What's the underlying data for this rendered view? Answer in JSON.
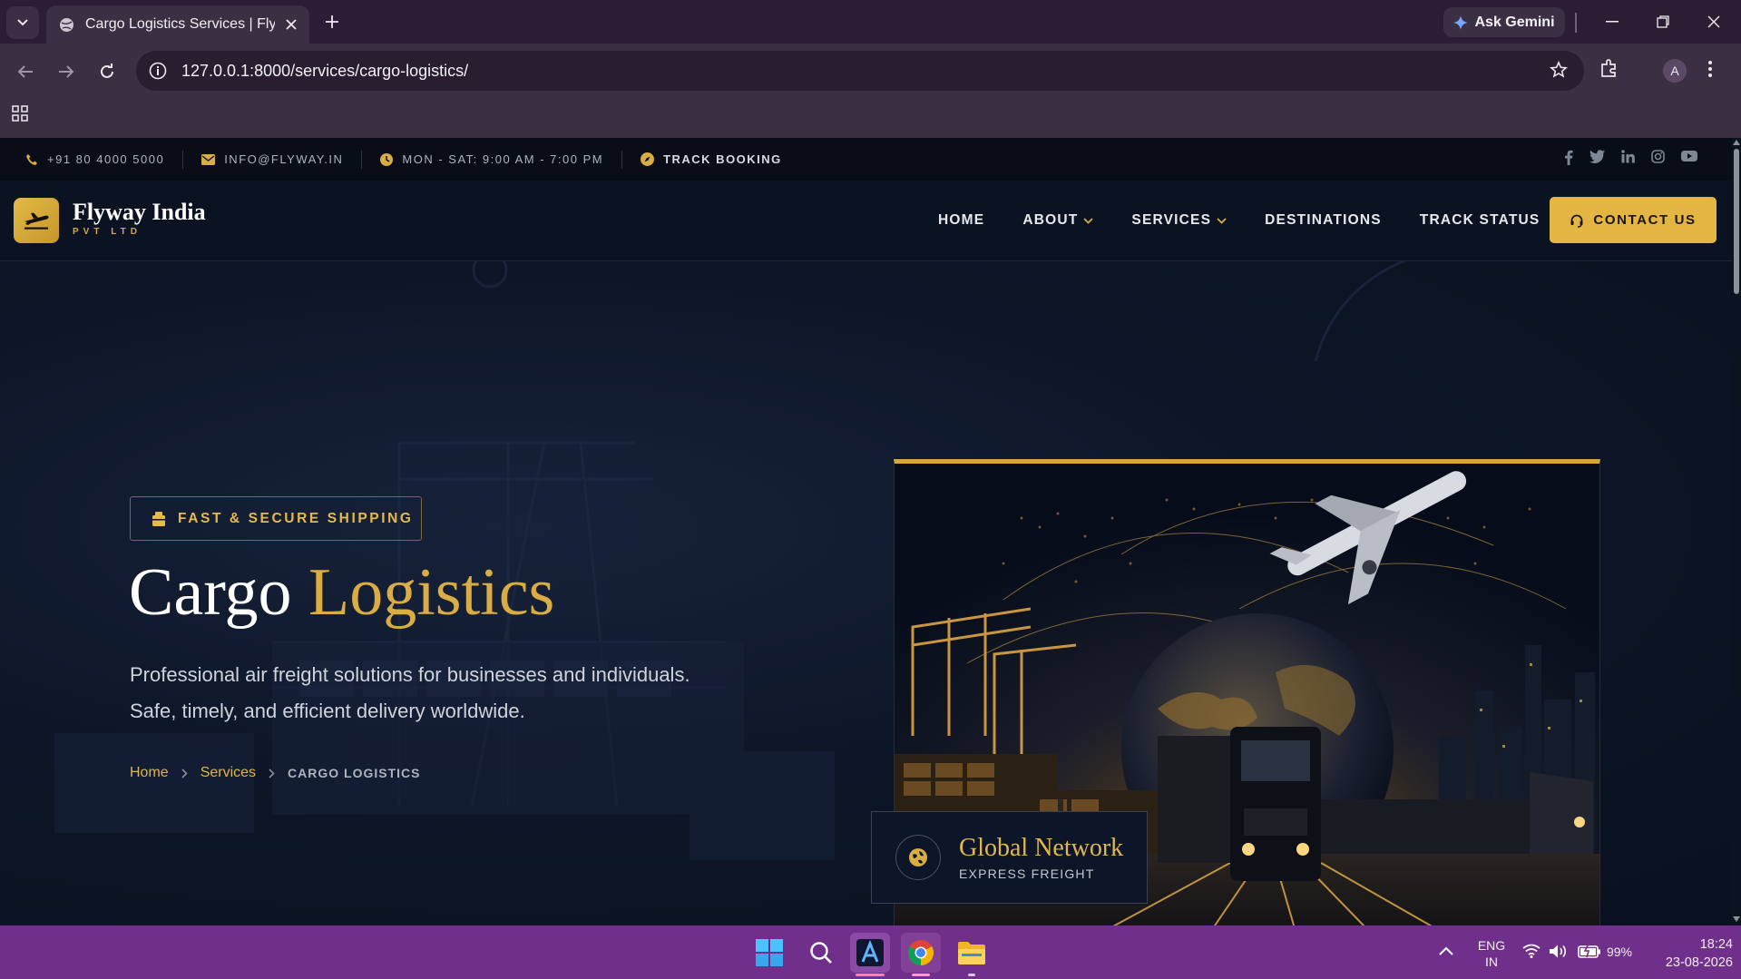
{
  "browser": {
    "tab_title": "Cargo Logistics Services | Flyway",
    "url": "127.0.0.1:8000/services/cargo-logistics/",
    "gemini_label": "Ask Gemini",
    "profile_initial": "A"
  },
  "topbar": {
    "phone": "+91 80 4000 5000",
    "email": "INFO@FLYWAY.IN",
    "hours": "MON - SAT: 9:00 AM - 7:00 PM",
    "track": "TRACK BOOKING"
  },
  "brand": {
    "name": "Flyway India",
    "sub": "PVT LTD"
  },
  "nav": {
    "home": "HOME",
    "about": "ABOUT",
    "services": "SERVICES",
    "destinations": "DESTINATIONS",
    "track": "TRACK STATUS",
    "contact": "CONTACT US"
  },
  "hero": {
    "badge": "FAST & SECURE SHIPPING",
    "title_a": "Cargo",
    "title_b": "Logistics",
    "lead_1": "Professional air freight solutions for businesses and individuals.",
    "lead_2": "Safe, timely, and efficient delivery worldwide.",
    "crumb_home": "Home",
    "crumb_services": "Services",
    "crumb_current": "CARGO LOGISTICS",
    "card_title": "Global Network",
    "card_sub": "EXPRESS FREIGHT"
  },
  "taskbar": {
    "lang_1": "ENG",
    "lang_2": "IN",
    "battery": "99%",
    "time": "18:24",
    "date": "23-08-2026"
  },
  "colors": {
    "gold": "#d9ad44",
    "navy": "#0c1424",
    "taskbar": "#6f2f8a"
  }
}
